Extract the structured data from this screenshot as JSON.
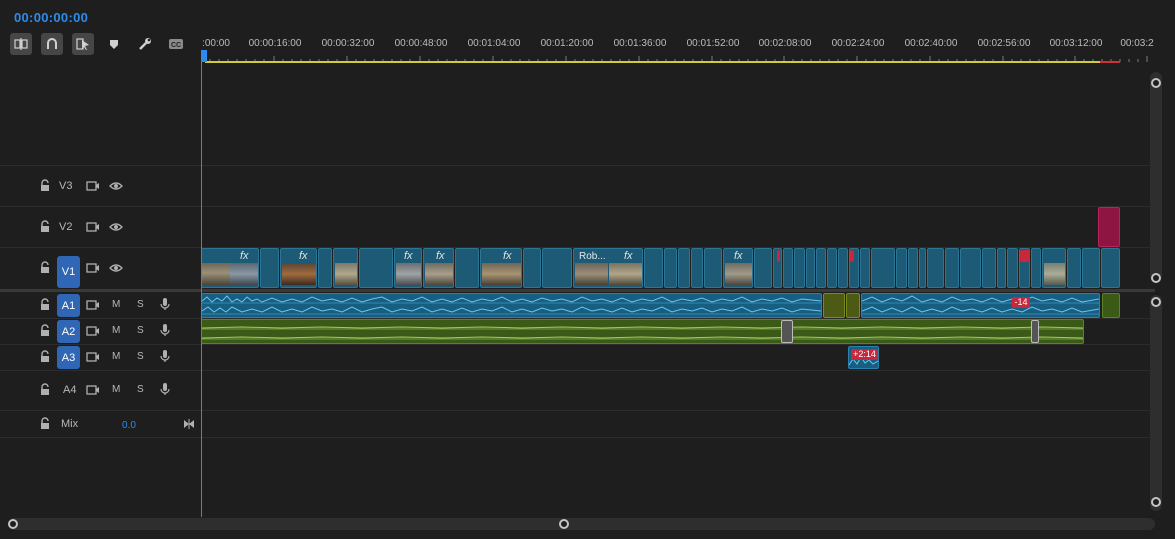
{
  "timeline": {
    "timecode": "00:00:00:00",
    "ruler_labels": [
      ":00:00",
      "00:00:16:00",
      "00:00:32:00",
      "00:00:48:00",
      "00:01:04:00",
      "00:01:20:00",
      "00:01:36:00",
      "00:01:52:00",
      "00:02:08:00",
      "00:02:24:00",
      "00:02:40:00",
      "00:02:56:00",
      "00:03:12:00",
      "00:03:2"
    ]
  },
  "toolbar": {
    "tools": [
      {
        "name": "insert-nest-icon"
      },
      {
        "name": "snap-icon"
      },
      {
        "name": "linked-selection-icon"
      },
      {
        "name": "add-marker-icon"
      },
      {
        "name": "wrench-icon"
      },
      {
        "name": "captions-icon"
      }
    ]
  },
  "tracks": {
    "video": [
      {
        "name": "V3",
        "active": false
      },
      {
        "name": "V2",
        "active": false
      },
      {
        "name": "V1",
        "active": true
      }
    ],
    "audio": [
      {
        "name": "A1",
        "active": true,
        "mute": "M",
        "solo": "S"
      },
      {
        "name": "A2",
        "active": true,
        "mute": "M",
        "solo": "S"
      },
      {
        "name": "A3",
        "active": true,
        "mute": "M",
        "solo": "S"
      },
      {
        "name": "A4",
        "active": false,
        "mute": "M",
        "solo": "S"
      }
    ],
    "mix": {
      "label": "Mix",
      "value": "0.0"
    }
  },
  "clips": {
    "fx_label": "fx",
    "named_clip": "Rob...",
    "markers": [
      "-14",
      "+2:14"
    ]
  },
  "colors": {
    "accent": "#2d8ceb",
    "video_clip": "#1c5a76",
    "audio_clip": "#185e80",
    "audio_green": "#3b5a18",
    "marker": "#c8283c",
    "work_area": "#cfcb3a"
  }
}
